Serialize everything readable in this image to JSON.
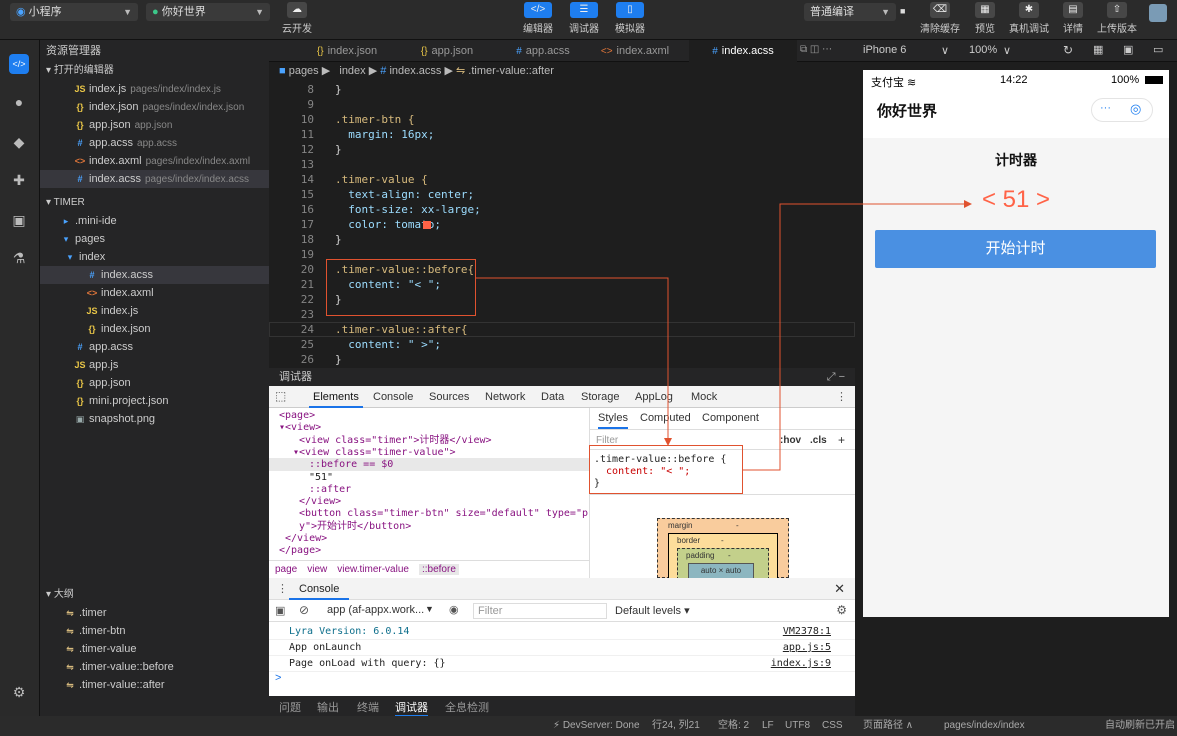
{
  "topbar": {
    "project_type": "小程序",
    "project_name": "你好世界",
    "cloud_label": "云开发",
    "center_tools": [
      "编辑器",
      "调试器",
      "模拟器"
    ],
    "compile_mode": "普通编译",
    "right_tools": [
      "清除缓存",
      "预览",
      "真机调试",
      "详情",
      "上传版本"
    ]
  },
  "tabs": [
    "index.json",
    "app.json",
    "app.acss",
    "index.axml",
    "index.acss"
  ],
  "active_tab": "index.acss",
  "device": {
    "name": "iPhone 6",
    "zoom": "100%"
  },
  "sidebar": {
    "title": "资源管理器",
    "open_editors_label": "打开的编辑器",
    "open_editors": [
      {
        "icon": "JS",
        "name": "index.js",
        "path": "pages/index/index.js"
      },
      {
        "icon": "{}",
        "name": "index.json",
        "path": "pages/index/index.json"
      },
      {
        "icon": "{}",
        "name": "app.json",
        "path": "app.json"
      },
      {
        "icon": "#",
        "name": "app.acss",
        "path": "app.acss"
      },
      {
        "icon": "<>",
        "name": "index.axml",
        "path": "pages/index/index.axml"
      },
      {
        "icon": "#",
        "name": "index.acss",
        "path": "pages/index/index.acss"
      }
    ],
    "project_label": "TIMER",
    "tree": [
      {
        "icon": "▸",
        "name": ".mini-ide"
      },
      {
        "icon": "▾",
        "name": "pages"
      },
      {
        "icon": "▾",
        "name": "index"
      },
      {
        "icon": "#",
        "name": "index.acss"
      },
      {
        "icon": "<>",
        "name": "index.axml"
      },
      {
        "icon": "JS",
        "name": "index.js"
      },
      {
        "icon": "{}",
        "name": "index.json"
      },
      {
        "icon": "#",
        "name": "app.acss"
      },
      {
        "icon": "JS",
        "name": "app.js"
      },
      {
        "icon": "{}",
        "name": "app.json"
      },
      {
        "icon": "{}",
        "name": "mini.project.json"
      },
      {
        "icon": "▣",
        "name": "snapshot.png"
      }
    ],
    "outline_label": "大纲",
    "outline": [
      ".timer",
      ".timer-btn",
      ".timer-value",
      ".timer-value::before",
      ".timer-value::after"
    ]
  },
  "breadcrumb": {
    "parts": [
      "pages",
      "index",
      "index.acss",
      ".timer-value::after"
    ]
  },
  "editor": {
    "line_numbers": [
      "8",
      "9",
      "10",
      "11",
      "12",
      "13",
      "14",
      "15",
      "16",
      "17",
      "18",
      "19",
      "20",
      "21",
      "22",
      "23",
      "24",
      "25",
      "26"
    ],
    "lines": [
      "}",
      "",
      ".timer-btn {",
      "  margin: 16px;",
      "}",
      "",
      ".timer-value {",
      "  text-align: center;",
      "  font-size: xx-large;",
      "  color: tomato;",
      "}",
      "",
      ".timer-value::before{",
      "  content: \"< \";",
      "}",
      "",
      ".timer-value::after{",
      "  content: \" >\";",
      "}"
    ]
  },
  "debugger": {
    "title": "调试器",
    "tabs": [
      "Elements",
      "Console",
      "Sources",
      "Network",
      "Data",
      "Storage",
      "AppLog",
      "Mock"
    ],
    "active": "Elements",
    "elements_lines": [
      "<page>",
      "▾<view>",
      "<view class=\"timer\">计时器</view>",
      "▾<view class=\"timer-value\">",
      "::before == $0",
      "\"51\"",
      "::after",
      "</view>",
      "<button class=\"timer-btn\" size=\"default\" type=\"primar",
      "y\">开始计时</button>",
      "</view>",
      "</page>"
    ],
    "element_crumbs": [
      "page",
      "view",
      "view.timer-value",
      "::before"
    ],
    "style_tabs": [
      "Styles",
      "Computed",
      "Component"
    ],
    "filter_placeholder": "Filter",
    "filter_tools": [
      ":hov",
      ".cls",
      "+"
    ],
    "style_rule": [
      ".timer-value::before {",
      "  content: \"< \";",
      "}"
    ],
    "boxmodel": {
      "margin": "margin",
      "border": "border",
      "padding": "padding",
      "content": "auto × auto",
      "dash": "-"
    }
  },
  "console": {
    "title": "Console",
    "context": "app (af-appx.work...",
    "filter_placeholder": "Filter",
    "levels": "Default levels ▾",
    "logs": [
      {
        "text": "Lyra Version: 6.0.14",
        "src": "VM2378:1"
      },
      {
        "text": "App onLaunch",
        "src": "app.js:5"
      },
      {
        "text": "Page onLoad with query: {}",
        "src": "index.js:9"
      }
    ],
    "prompt": ">"
  },
  "bottom_tabs": [
    "问题",
    "输出",
    "终端",
    "调试器",
    "全息检测"
  ],
  "statusbar": {
    "devserver": "DevServer: Done",
    "position": "行24, 列21",
    "spaces": "空格: 2",
    "eol": "LF",
    "encoding": "UTF8",
    "lang": "CSS",
    "page_path_label": "页面路径 ∧",
    "page_path": "pages/index/index",
    "autorefresh": "自动刷新已开启"
  },
  "phone": {
    "carrier": "支付宝",
    "time": "14:22",
    "battery": "100%",
    "nav_title": "你好世界",
    "page_title": "计时器",
    "timer_value": "< 51 >",
    "button": "开始计时"
  },
  "colors": {
    "accent": "#1e7ef0",
    "highlight": "#e0522f",
    "tomato": "#ff6347",
    "button": "#4a90e2"
  }
}
